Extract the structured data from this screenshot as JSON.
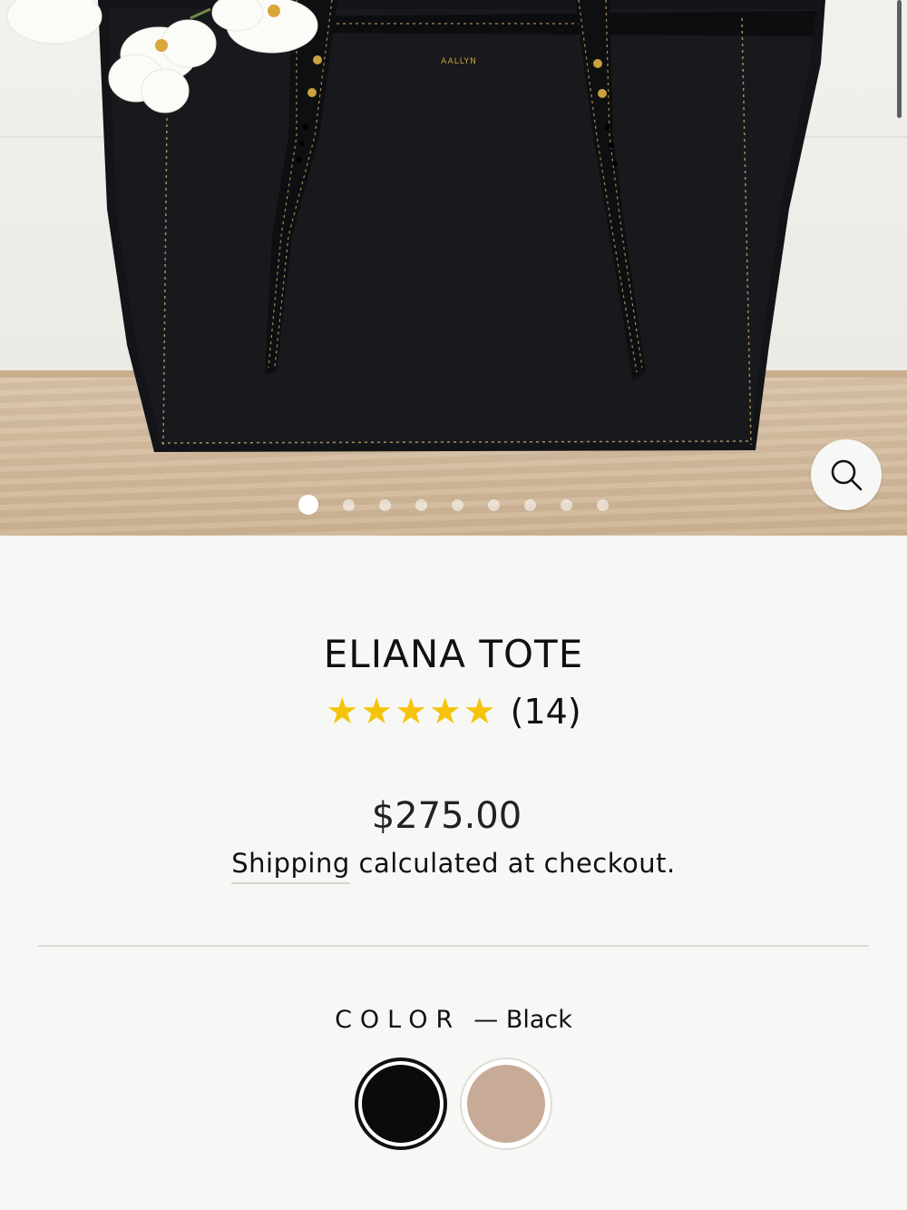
{
  "product": {
    "title": "ELIANA TOTE",
    "rating": {
      "stars": 5,
      "review_count_label": "(14)"
    },
    "price": "$275.00",
    "shipping": {
      "link_label": "Shipping",
      "suffix": " calculated at checkout."
    },
    "brand_stamp": "AALLYN"
  },
  "gallery": {
    "image_count": 9,
    "active_index": 0,
    "zoom_icon": "search-icon"
  },
  "options": {
    "color": {
      "label": "COLOR",
      "selected_text": "— Black",
      "swatches": [
        {
          "name": "Black",
          "color": "#0b0b0b",
          "selected": true
        },
        {
          "name": "Taupe",
          "color": "#c7ab96",
          "selected": false
        }
      ]
    }
  },
  "colors": {
    "star": "#f6c30b",
    "background": "#f7f8f5",
    "text": "#111111"
  }
}
